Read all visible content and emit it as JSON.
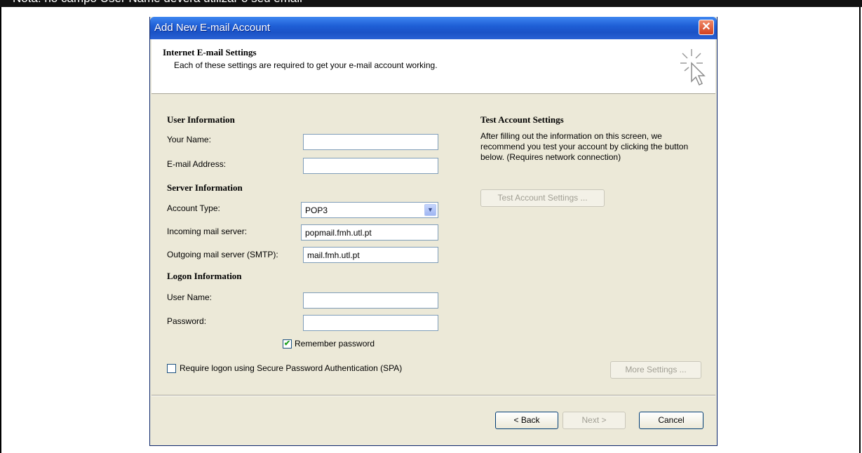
{
  "banner": {
    "text": "Nota: no campo User Name deverá utilizar o seu email"
  },
  "window": {
    "title": "Add New E-mail Account",
    "close_label": "✕"
  },
  "header": {
    "title": "Internet E-mail Settings",
    "subtitle": "Each of these settings are required to get your e-mail account working."
  },
  "user_info": {
    "section": "User Information",
    "your_name_label": "Your Name:",
    "your_name_value": "",
    "email_label": "E-mail Address:",
    "email_value": ""
  },
  "server_info": {
    "section": "Server Information",
    "account_type_label": "Account Type:",
    "account_type_value": "POP3",
    "incoming_label": "Incoming mail server:",
    "incoming_value": "popmail.fmh.utl.pt",
    "outgoing_label": "Outgoing mail server (SMTP):",
    "outgoing_value": "mail.fmh.utl.pt"
  },
  "logon_info": {
    "section": "Logon Information",
    "username_label": "User Name:",
    "username_value": "",
    "password_label": "Password:",
    "password_value": "",
    "remember_label": "Remember password",
    "remember_checked": true,
    "spa_label": "Require logon using Secure Password Authentication (SPA)",
    "spa_checked": false
  },
  "test": {
    "section": "Test Account Settings",
    "help": "After filling out the information on this screen, we recommend you test your account by clicking the button below. (Requires network connection)",
    "button": "Test Account Settings ..."
  },
  "buttons": {
    "more_settings": "More Settings ...",
    "back": "< Back",
    "next": "Next >",
    "cancel": "Cancel"
  }
}
